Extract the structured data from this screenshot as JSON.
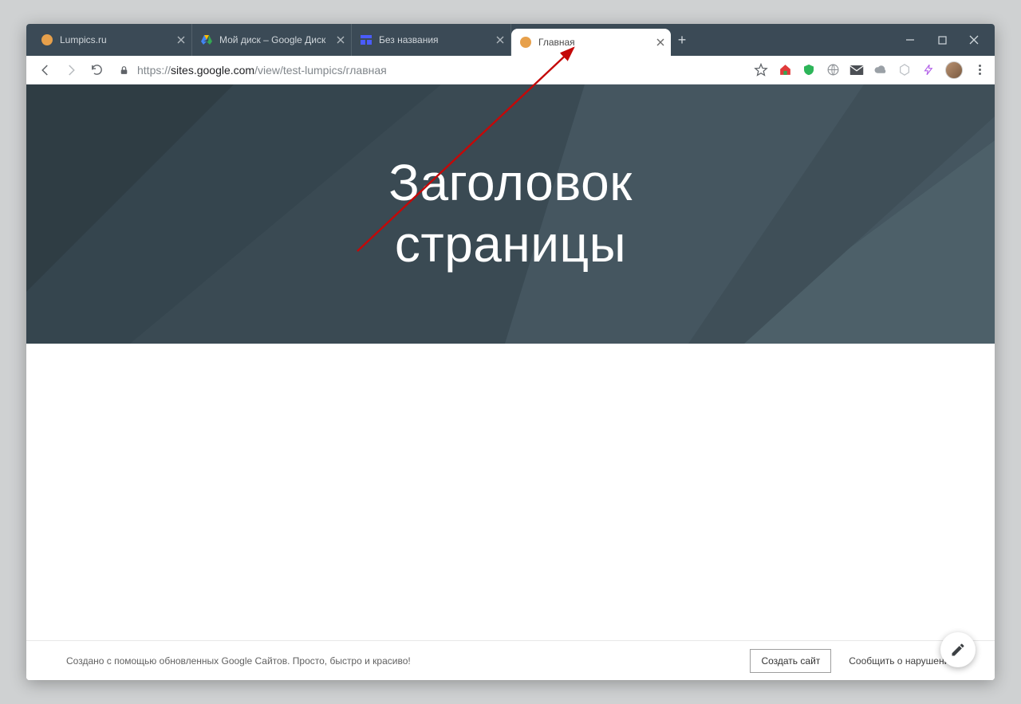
{
  "window": {
    "tabs": [
      {
        "title": "Lumpics.ru",
        "active": false,
        "icon": "lumpics"
      },
      {
        "title": "Мой диск – Google Диск",
        "active": false,
        "icon": "drive"
      },
      {
        "title": "Без названия",
        "active": false,
        "icon": "sites"
      },
      {
        "title": "Главная",
        "active": true,
        "icon": "lumpics"
      }
    ]
  },
  "address": {
    "scheme": "https://",
    "host": "sites.google.com",
    "path": "/view/test-lumpics/главная"
  },
  "banner": {
    "heading_line1": "Заголовок",
    "heading_line2": "страницы"
  },
  "footer": {
    "blurb": "Создано с помощью обновленных Google Сайтов. Просто, быстро и красиво!",
    "create_label": "Создать сайт",
    "report_label": "Сообщить о нарушении"
  },
  "colors": {
    "tabbar": "#3b4a56",
    "banner_dark": "#2f3d44",
    "banner_mid": "#3a4a53",
    "banner_light": "#4d6069",
    "arrow": "#c40808"
  }
}
